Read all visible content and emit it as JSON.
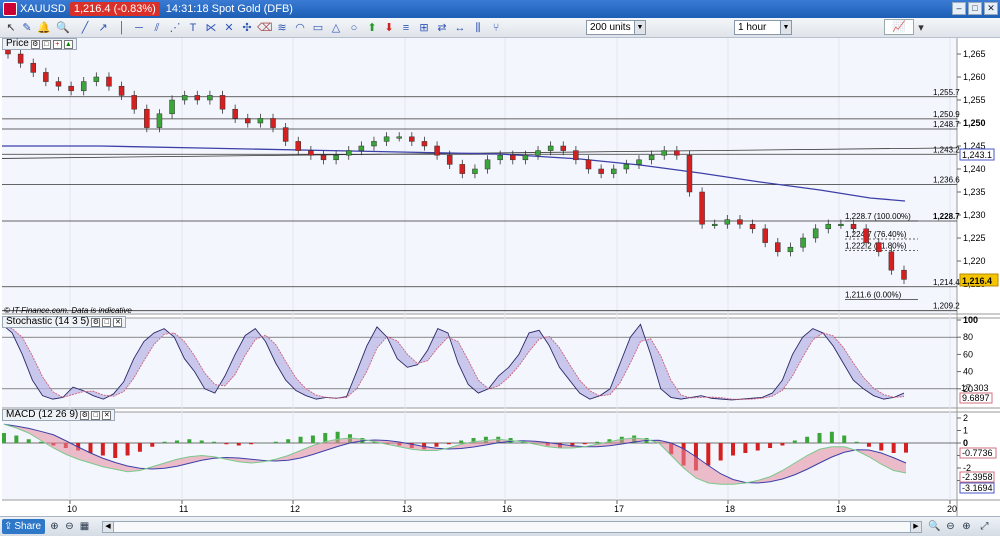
{
  "titlebar": {
    "symbol": "XAUUSD",
    "price_change": "1,216.4 (-0.83%)",
    "title": "14:31:18 Spot Gold (DFB)"
  },
  "toolbar": {
    "units_select": "200 units",
    "interval_select": "1 hour"
  },
  "panels": {
    "price_label": "Price",
    "stochastic_label": "Stochastic (14 3 5)",
    "macd_label": "MACD (12 26 9)"
  },
  "watermark": "© IT-Finance.com. Data is indicative",
  "price_axis": {
    "ticks": [
      "1,265",
      "1,260",
      "1,255",
      "1,250",
      "1,245",
      "1,240",
      "1,235",
      "1,230",
      "1,225",
      "1,220",
      "1,215"
    ],
    "current_price": "1,216.4",
    "ma_value": "1,243.1"
  },
  "levels": [
    {
      "label": "1,255.7"
    },
    {
      "label": "1,250.9"
    },
    {
      "label": "1,248.7"
    },
    {
      "label": "1,243.2"
    },
    {
      "label": "1,236.6"
    },
    {
      "label": "1,228.7"
    },
    {
      "label": "1,214.4"
    },
    {
      "label": "1,209.2"
    }
  ],
  "fib_labels": [
    "1,228.7 (100.00%)",
    "1,224.7 (76.40%)",
    "1,222.2 (61.80%)",
    "1,211.6 (0.00%)"
  ],
  "stochastic_axis": {
    "ticks": [
      "100",
      "80",
      "60",
      "40",
      "20"
    ],
    "k_value": "17.303",
    "d_value": "9.6897"
  },
  "macd_axis": {
    "ticks": [
      "2",
      "1",
      "0",
      "-1",
      "-2",
      "-3"
    ],
    "hist_value": "-0.7736",
    "macd_value": "-2.3958",
    "signal_value": "-3.1694"
  },
  "time_axis": [
    "10",
    "11",
    "12",
    "13",
    "16",
    "17",
    "18",
    "19",
    "20"
  ],
  "bottombar": {
    "share_label": "Share"
  },
  "chart_data": {
    "type": "candlestick",
    "interval": "1 hour",
    "price_range": [
      1209,
      1267
    ],
    "candles_close_approx": [
      1265,
      1263,
      1261,
      1259,
      1258,
      1257,
      1259,
      1260,
      1258,
      1256,
      1253,
      1249,
      1252,
      1255,
      1256,
      1255,
      1256,
      1253,
      1251,
      1250,
      1251,
      1249,
      1246,
      1244,
      1243,
      1242,
      1243,
      1244,
      1245,
      1246,
      1247,
      1247,
      1246,
      1245,
      1243,
      1241,
      1239,
      1240,
      1242,
      1243,
      1242,
      1243,
      1244,
      1245,
      1244,
      1242,
      1240,
      1239,
      1240,
      1241,
      1242,
      1243,
      1244,
      1243,
      1235,
      1228,
      1228,
      1229,
      1228,
      1227,
      1224,
      1222,
      1223,
      1225,
      1227,
      1228,
      1228,
      1227,
      1224,
      1222,
      1218,
      1216
    ],
    "stochastic_range": [
      0,
      100
    ],
    "macd_range": [
      -3.5,
      2.5
    ]
  }
}
